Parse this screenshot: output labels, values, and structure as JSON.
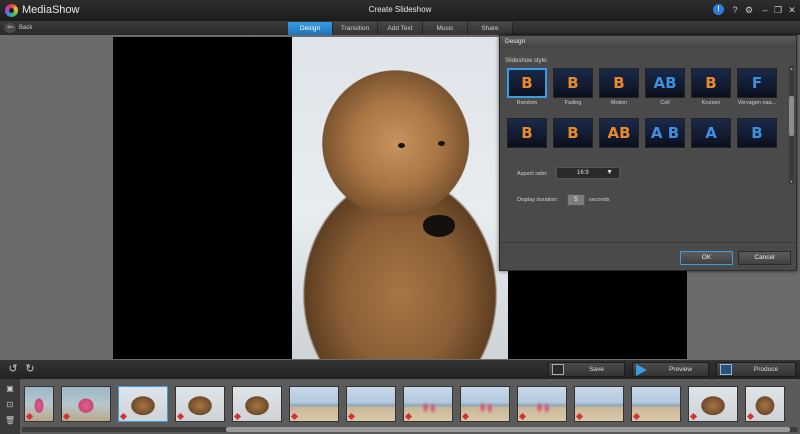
{
  "app": {
    "name": "MediaShow",
    "window_title": "Create Slideshow",
    "controls": {
      "update": "!",
      "help": "?",
      "settings": "⚙",
      "minimize": "–",
      "restore": "❐",
      "close": "✕"
    }
  },
  "nav": {
    "back_label": "Back",
    "back_glyph": "⇦",
    "tabs": [
      "Design",
      "Transition",
      "Add Text",
      "Music",
      "Share"
    ],
    "active_tab": "Design"
  },
  "dialog": {
    "title": "Design",
    "style_label": "Slideshow style:",
    "styles": [
      {
        "name": "Random",
        "glyph": "B",
        "selected": true
      },
      {
        "name": "Fading",
        "glyph": "B"
      },
      {
        "name": "Motion",
        "glyph": "B"
      },
      {
        "name": "Cell",
        "glyph": "AB"
      },
      {
        "name": "Kruisen",
        "glyph": "B"
      },
      {
        "name": "Vervagen naa...",
        "glyph": "F"
      },
      {
        "name": "",
        "glyph": "B"
      },
      {
        "name": "",
        "glyph": "B"
      },
      {
        "name": "",
        "glyph": "AB"
      },
      {
        "name": "",
        "glyph": "A B"
      },
      {
        "name": "",
        "glyph": "A"
      },
      {
        "name": "",
        "glyph": "B"
      }
    ],
    "aspect_ratio_label": "Aspect ratio:",
    "aspect_ratio_value": "16:9",
    "aspect_caret": "▼",
    "display_duration_label": "Display duration:",
    "display_duration_value": "5",
    "seconds_label": "seconds",
    "ok_label": "OK",
    "cancel_label": "Cancel"
  },
  "toolbar": {
    "rotate_left": "↺",
    "rotate_right": "↻",
    "save_label": "Save",
    "preview_label": "Preview",
    "produce_label": "Produce"
  },
  "filmstrip": {
    "tools": [
      "▣",
      "⊡",
      "🗑"
    ],
    "clips": [
      {
        "kind": "pink"
      },
      {
        "kind": "pink"
      },
      {
        "kind": "dog",
        "selected": true
      },
      {
        "kind": "dog"
      },
      {
        "kind": "dog"
      },
      {
        "kind": "beach"
      },
      {
        "kind": "beach"
      },
      {
        "kind": "beachkids"
      },
      {
        "kind": "beachkids"
      },
      {
        "kind": "beachkids"
      },
      {
        "kind": "beach"
      },
      {
        "kind": "beach"
      },
      {
        "kind": "dog"
      },
      {
        "kind": "dog"
      }
    ]
  }
}
